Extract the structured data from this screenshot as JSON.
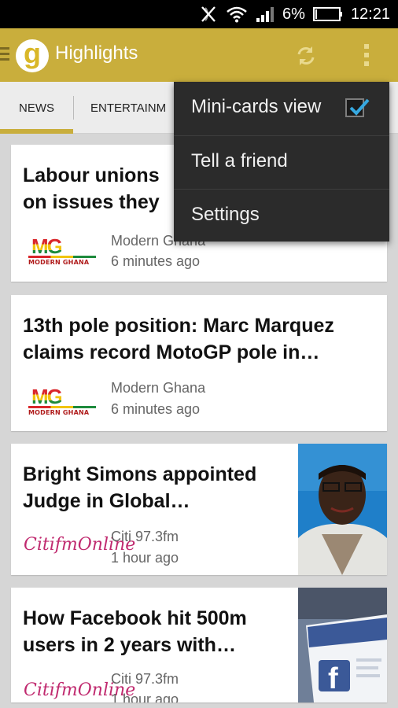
{
  "status_bar": {
    "battery": "6%",
    "time": "12:21",
    "icons": [
      "mute-icon",
      "wifi-icon",
      "signal-icon",
      "battery-icon"
    ]
  },
  "action_bar": {
    "app_logo_letter": "g",
    "title": "Highlights",
    "icons": [
      "menu-icon",
      "refresh-icon",
      "overflow-icon"
    ],
    "color": "#c9ae3c"
  },
  "tabs": [
    {
      "label": "NEWS",
      "selected": true
    },
    {
      "label": "ENTERTAINM",
      "selected": false
    }
  ],
  "overflow_menu": {
    "items": [
      {
        "label": "Mini-cards view",
        "checked": true
      },
      {
        "label": "Tell a friend"
      },
      {
        "label": "Settings"
      }
    ]
  },
  "articles": [
    {
      "title_line1": "Labour unions",
      "title_line2": "on issues they",
      "source": "Modern Ghana",
      "time": "6 minutes ago",
      "source_logo": {
        "name": "modern-ghana-logo",
        "letters": "MG",
        "subtitle": "MODERN GHANA"
      }
    },
    {
      "title_line1": "13th pole position: Marc Marquez",
      "title_line2": "claims record MotoGP pole in…",
      "source": "Modern Ghana",
      "time": "6 minutes ago",
      "source_logo": {
        "name": "modern-ghana-logo",
        "letters": "MG",
        "subtitle": "MODERN GHANA"
      }
    },
    {
      "title_line1": "Bright Simons appointed",
      "title_line2": "Judge in Global…",
      "source": "Citi 97.3fm",
      "time": "1 hour ago",
      "source_logo": {
        "name": "citifm-online-logo",
        "text": "CitifmOnline"
      },
      "thumbnail": "portrait-photo"
    },
    {
      "title_line1": "How Facebook hit 500m",
      "title_line2": "users in 2 years with…",
      "source": "Citi 97.3fm",
      "time": "1 hour ago",
      "source_logo": {
        "name": "citifm-online-logo",
        "text": "CitifmOnline"
      },
      "thumbnail": "facebook-screen-photo"
    }
  ]
}
